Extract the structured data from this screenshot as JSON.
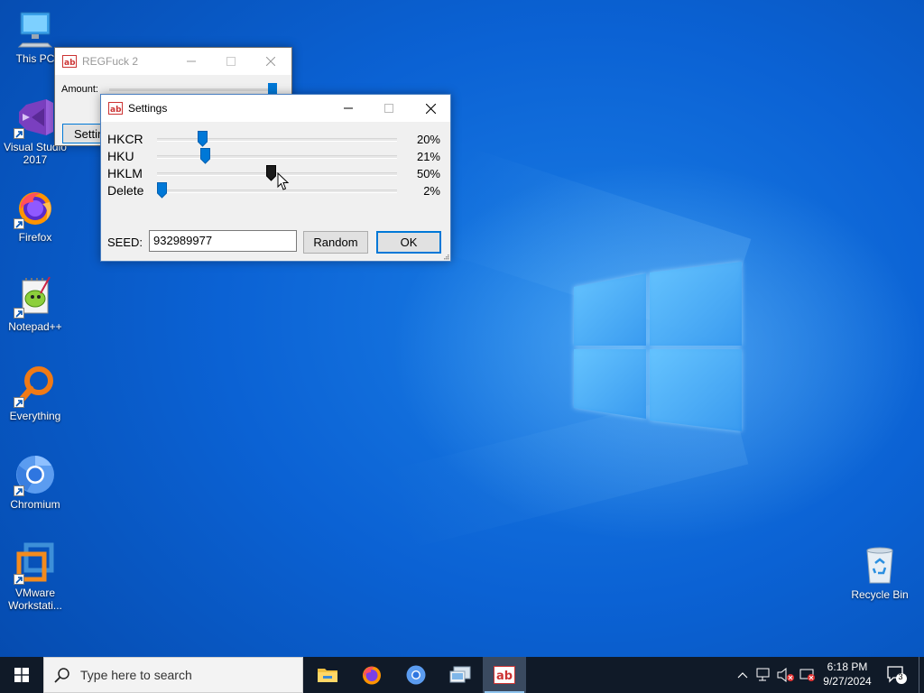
{
  "desktop": {
    "icons": [
      {
        "label": "This PC"
      },
      {
        "label": "Visual Studio 2017"
      },
      {
        "label": "Firefox"
      },
      {
        "label": "Notepad++"
      },
      {
        "label": "Everything"
      },
      {
        "label": "Chromium"
      },
      {
        "label": "VMware Workstati..."
      },
      {
        "label": "Recycle Bin"
      }
    ]
  },
  "main_window": {
    "title": "REGFuck 2",
    "amount_label": "Amount:",
    "settings_button": "Settings"
  },
  "settings": {
    "title": "Settings",
    "rows": [
      {
        "label": "HKCR",
        "pct": "20%",
        "value": 20
      },
      {
        "label": "HKU",
        "pct": "21%",
        "value": 21
      },
      {
        "label": "HKLM",
        "pct": "50%",
        "value": 50
      },
      {
        "label": "Delete",
        "pct": "2%",
        "value": 2
      }
    ],
    "seed_label": "SEED:",
    "seed_value": "932989977",
    "random_button": "Random",
    "ok_button": "OK"
  },
  "taskbar": {
    "search_placeholder": "Type here to search",
    "time": "6:18 PM",
    "date": "9/27/2024",
    "notification_count": "3"
  },
  "colors": {
    "accent": "#0078d7",
    "taskbar": "#101a28"
  }
}
